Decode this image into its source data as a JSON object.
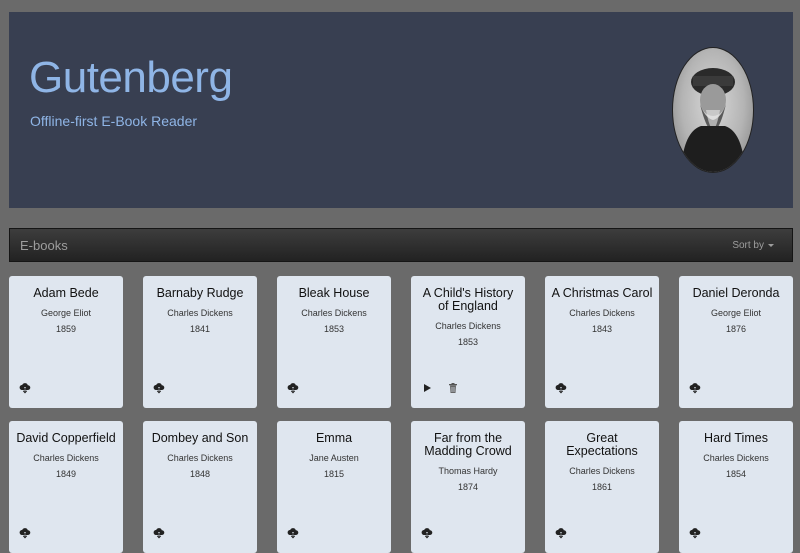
{
  "hero": {
    "title": "Gutenberg",
    "subtitle": "Offline-first E-Book Reader"
  },
  "navbar": {
    "brand": "E-books",
    "sort_label": "Sort by"
  },
  "books": [
    {
      "title": "Adam Bede",
      "author": "George Eliot",
      "year": "1859",
      "actions": [
        "download-icon"
      ]
    },
    {
      "title": "Barnaby Rudge",
      "author": "Charles Dickens",
      "year": "1841",
      "actions": [
        "download-icon"
      ]
    },
    {
      "title": "Bleak House",
      "author": "Charles Dickens",
      "year": "1853",
      "actions": [
        "download-icon"
      ]
    },
    {
      "title": "A Child's History of England",
      "author": "Charles Dickens",
      "year": "1853",
      "actions": [
        "play-icon",
        "trash-icon"
      ]
    },
    {
      "title": "A Christmas Carol",
      "author": "Charles Dickens",
      "year": "1843",
      "actions": [
        "download-icon"
      ]
    },
    {
      "title": "Daniel Deronda",
      "author": "George Eliot",
      "year": "1876",
      "actions": [
        "download-icon"
      ]
    },
    {
      "title": "David Copperfield",
      "author": "Charles Dickens",
      "year": "1849",
      "actions": [
        "download-icon"
      ]
    },
    {
      "title": "Dombey and Son",
      "author": "Charles Dickens",
      "year": "1848",
      "actions": [
        "download-icon"
      ]
    },
    {
      "title": "Emma",
      "author": "Jane Austen",
      "year": "1815",
      "actions": [
        "download-icon"
      ]
    },
    {
      "title": "Far from the Madding Crowd",
      "author": "Thomas Hardy",
      "year": "1874",
      "actions": [
        "download-icon"
      ]
    },
    {
      "title": "Great Expectations",
      "author": "Charles Dickens",
      "year": "1861",
      "actions": [
        "download-icon"
      ]
    },
    {
      "title": "Hard Times",
      "author": "Charles Dickens",
      "year": "1854",
      "actions": [
        "download-icon"
      ]
    }
  ]
}
